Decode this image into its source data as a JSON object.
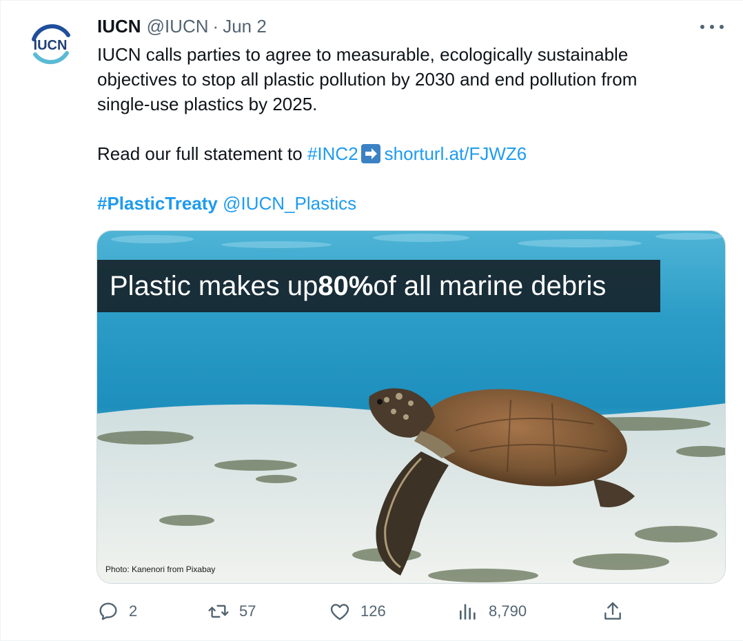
{
  "tweet": {
    "display_name": "IUCN",
    "handle": "@IUCN",
    "separator": "·",
    "date": "Jun 2",
    "avatar_text": "IUCN",
    "text_line1": "IUCN calls parties to agree to measurable, ecologically sustainable",
    "text_line2": "objectives to stop all plastic pollution by 2030 and end pollution from",
    "text_line3": "single-use plastics by 2025.",
    "read_prefix": "Read our full statement to ",
    "hashtag_inc": "#INC2",
    "url": "shorturl.at/FJWZ6",
    "hashtag_treaty": "#PlasticTreaty",
    "mention": "@IUCN_Plastics"
  },
  "media": {
    "banner_pre": "Plastic makes up ",
    "banner_bold": "80%",
    "banner_post": " of all marine debris",
    "credit": "Photo: Kanenori from Pixabay"
  },
  "actions": {
    "replies": "2",
    "retweets": "57",
    "likes": "126",
    "views": "8,790"
  },
  "icons": {
    "more": "more-options-icon",
    "reply": "reply-icon",
    "retweet": "retweet-icon",
    "like": "heart-icon",
    "views": "views-icon",
    "share": "share-icon",
    "arrow": "right-arrow-emoji-icon"
  },
  "colors": {
    "link": "#1d9bf0",
    "secondary": "#536471",
    "text": "#0f1419"
  }
}
